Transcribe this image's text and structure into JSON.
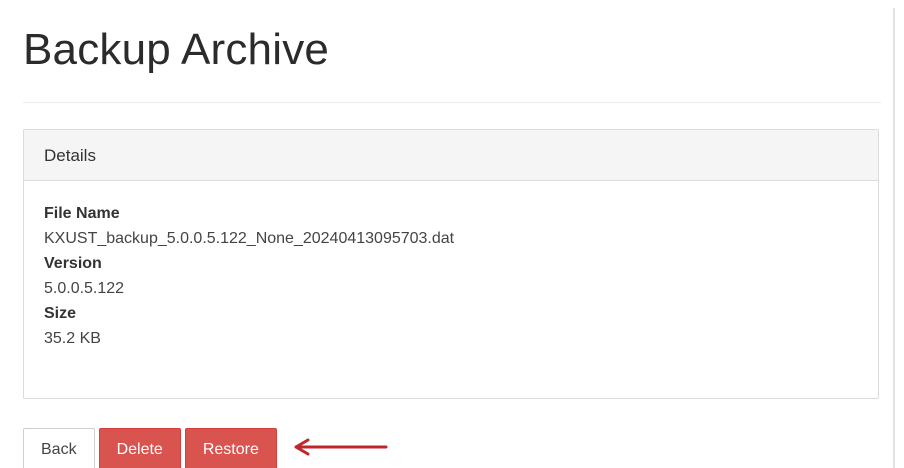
{
  "page": {
    "title": "Backup Archive"
  },
  "panel": {
    "heading": "Details",
    "fields": [
      {
        "label": "File Name",
        "value": "KXUST_backup_5.0.0.5.122_None_20240413095703.dat"
      },
      {
        "label": "Version",
        "value": "5.0.0.5.122"
      },
      {
        "label": "Size",
        "value": "35.2 KB"
      }
    ]
  },
  "actions": {
    "back_label": "Back",
    "delete_label": "Delete",
    "restore_label": "Restore"
  },
  "annotation": {
    "arrow_icon": "left-arrow-icon",
    "arrow_color": "#c0272d"
  },
  "colors": {
    "danger": "#d9534f",
    "panel_heading_bg": "#f5f5f5"
  }
}
